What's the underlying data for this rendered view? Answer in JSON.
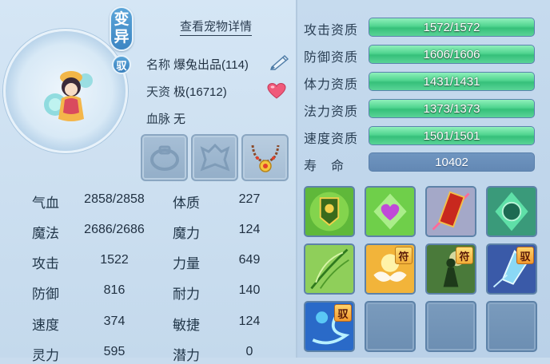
{
  "pet": {
    "mutation_badge": [
      "变",
      "异"
    ],
    "ride_badge": "驭",
    "detail_link": "查看宠物详情",
    "name_label": "名称",
    "name_value": "爆兔出品(114)",
    "talent_label": "天资",
    "talent_value": "极(16712)",
    "bloodline_label": "血脉",
    "bloodline_value": "无"
  },
  "equipment": [
    {
      "name": "ring-slot",
      "icon": "ring-icon",
      "equipped": false
    },
    {
      "name": "armor-slot",
      "icon": "armor-icon",
      "equipped": false
    },
    {
      "name": "necklace-slot",
      "icon": "necklace-icon",
      "equipped": true
    }
  ],
  "stats": {
    "left": [
      {
        "label": "气血",
        "value": "2858/2858"
      },
      {
        "label": "魔法",
        "value": "2686/2686"
      },
      {
        "label": "攻击",
        "value": "1522"
      },
      {
        "label": "防御",
        "value": "816"
      },
      {
        "label": "速度",
        "value": "374"
      },
      {
        "label": "灵力",
        "value": "595"
      }
    ],
    "right": [
      {
        "label": "体质",
        "value": "227"
      },
      {
        "label": "魔力",
        "value": "124"
      },
      {
        "label": "力量",
        "value": "649"
      },
      {
        "label": "耐力",
        "value": "140"
      },
      {
        "label": "敏捷",
        "value": "124"
      },
      {
        "label": "潜力",
        "value": "0"
      }
    ]
  },
  "aptitudes": [
    {
      "label": "攻击资质",
      "text": "1572/1572",
      "fill": 1.0
    },
    {
      "label": "防御资质",
      "text": "1606/1606",
      "fill": 1.0
    },
    {
      "label": "体力资质",
      "text": "1431/1431",
      "fill": 1.0
    },
    {
      "label": "法力资质",
      "text": "1373/1373",
      "fill": 1.0
    },
    {
      "label": "速度资质",
      "text": "1501/1501",
      "fill": 1.0
    }
  ],
  "life": {
    "label": "寿　命",
    "value": "10402"
  },
  "skills": [
    {
      "icon": "shield-banner-icon",
      "tag": ""
    },
    {
      "icon": "heart-gem-icon",
      "tag": ""
    },
    {
      "icon": "red-scroll-icon",
      "tag": ""
    },
    {
      "icon": "green-guard-icon",
      "tag": ""
    },
    {
      "icon": "leaf-icon",
      "tag": ""
    },
    {
      "icon": "golden-wings-icon",
      "tag": "符"
    },
    {
      "icon": "green-warrior-icon",
      "tag": "符"
    },
    {
      "icon": "ice-crystal-icon",
      "tag": "驭"
    },
    {
      "icon": "blue-whirl-icon",
      "tag": "驭"
    },
    {
      "icon": "",
      "tag": ""
    },
    {
      "icon": "",
      "tag": ""
    },
    {
      "icon": "",
      "tag": ""
    }
  ],
  "colors": {
    "bar_green": "#4fd48f",
    "panel_blue": "#c6dbee",
    "badge_blue": "#3d86c3"
  }
}
